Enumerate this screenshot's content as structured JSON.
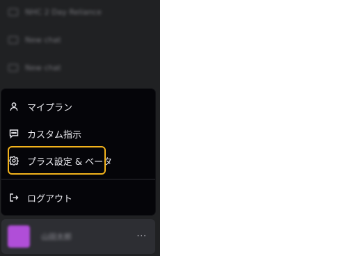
{
  "history": [
    {
      "label": "NHC 2 Day Reliance"
    },
    {
      "label": "New chat"
    },
    {
      "label": "New chat"
    }
  ],
  "menu": {
    "items": [
      {
        "label": "マイプラン",
        "icon": "user-icon"
      },
      {
        "label": "カスタム指示",
        "icon": "message-square-icon"
      },
      {
        "label": "プラス設定 & ベータ",
        "icon": "gear-icon"
      }
    ],
    "logout": {
      "label": "ログアウト",
      "icon": "logout-icon"
    }
  },
  "profile": {
    "name": "山田太郎",
    "more": "···"
  },
  "colors": {
    "sidebar": "#202123",
    "menu": "#050509",
    "highlight": "#f3b31c",
    "avatar": "#b04ed8"
  }
}
